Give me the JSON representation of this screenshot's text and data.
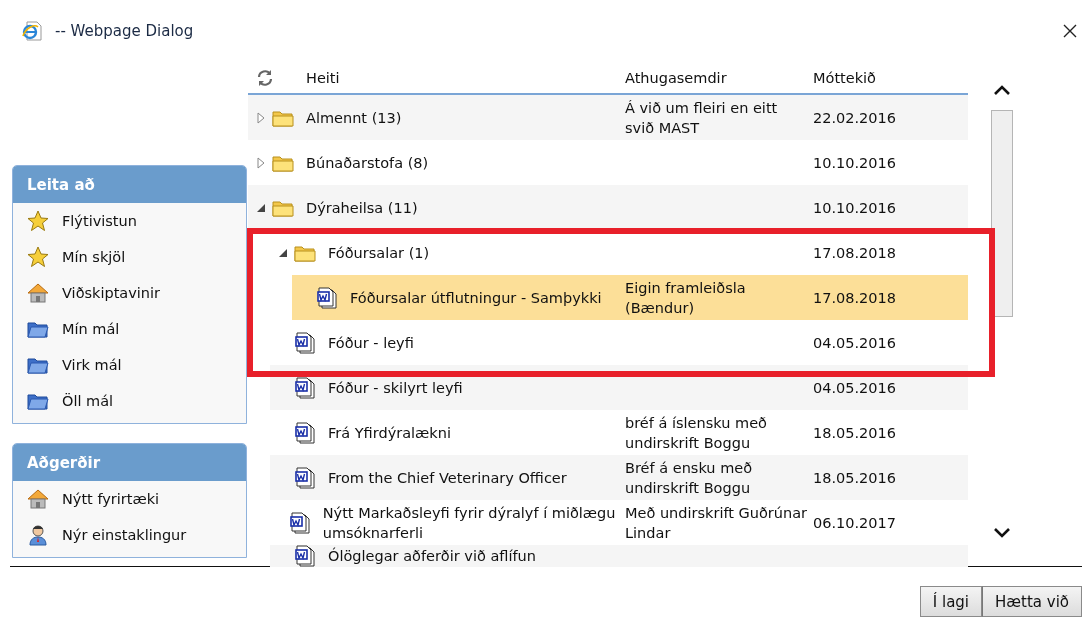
{
  "window": {
    "title": "-- Webpage Dialog"
  },
  "sidebar": [
    {
      "heading": "Leita að",
      "items": [
        {
          "kind": "star",
          "label": "Flýtivistun"
        },
        {
          "kind": "star",
          "label": "Mín skjöl"
        },
        {
          "kind": "house",
          "label": "Viðskiptavinir"
        },
        {
          "kind": "folder",
          "label": "Mín mál"
        },
        {
          "kind": "folder",
          "label": "Virk mál"
        },
        {
          "kind": "folder",
          "label": "Öll mál"
        }
      ]
    },
    {
      "heading": "Aðgerðir",
      "items": [
        {
          "kind": "house",
          "label": "Nýtt fyrirtæki"
        },
        {
          "kind": "person",
          "label": "Nýr einstaklingur"
        }
      ]
    }
  ],
  "table": {
    "columns": [
      "Heiti",
      "Athugasemdir",
      "Móttekið"
    ],
    "rows": [
      {
        "kind": "folder",
        "name": "Almennt (13)",
        "comment": "Á við um fleiri en eitt svið MAST",
        "date": "22.02.2016",
        "expanded": false,
        "selected": false
      },
      {
        "kind": "folder",
        "name": "Búnaðarstofa (8)",
        "date": "10.10.2016",
        "expanded": false,
        "selected": false
      },
      {
        "kind": "folder",
        "name": "Dýraheilsa (11)",
        "date": "10.10.2016",
        "expanded": true,
        "selected": false,
        "children": [
          {
            "kind": "folder",
            "name": "Fóðursalar (1)",
            "date": "17.08.2018",
            "expanded": true,
            "selected": false,
            "children": [
              {
                "kind": "document",
                "name": "Fóðursalar útflutningur - Samþykki",
                "comment": "Eigin framleiðsla (Bændur)",
                "date": "17.08.2018",
                "selected": true
              }
            ]
          },
          {
            "kind": "document",
            "name": "Fóður - leyfi",
            "date": "04.05.2016",
            "selected": false
          },
          {
            "kind": "document",
            "name": "Fóður - skilyrt leyfi",
            "date": "04.05.2016",
            "selected": false
          },
          {
            "kind": "document",
            "name": "Frá Yfirdýralækni",
            "comment": "bréf á íslensku með undirskrift Boggu",
            "date": "18.05.2016",
            "selected": false
          },
          {
            "kind": "document",
            "name": "From the Chief Veterinary Officer",
            "comment": "Bréf á ensku með undirskrift Boggu",
            "date": "18.05.2016",
            "selected": false
          },
          {
            "kind": "document",
            "name": "Nýtt Markaðsleyfi fyrir dýralyf í miðlægu umsóknarferli",
            "comment": "Með undirskrift Guðrúnar Lindar",
            "date": "06.10.2017",
            "selected": false
          },
          {
            "kind": "document",
            "name": "Ólöglegar aðferðir við aflífun",
            "selected": false
          }
        ]
      }
    ]
  },
  "highlight_frame": true,
  "buttons": [
    "Í lagi",
    "Hætta við"
  ]
}
